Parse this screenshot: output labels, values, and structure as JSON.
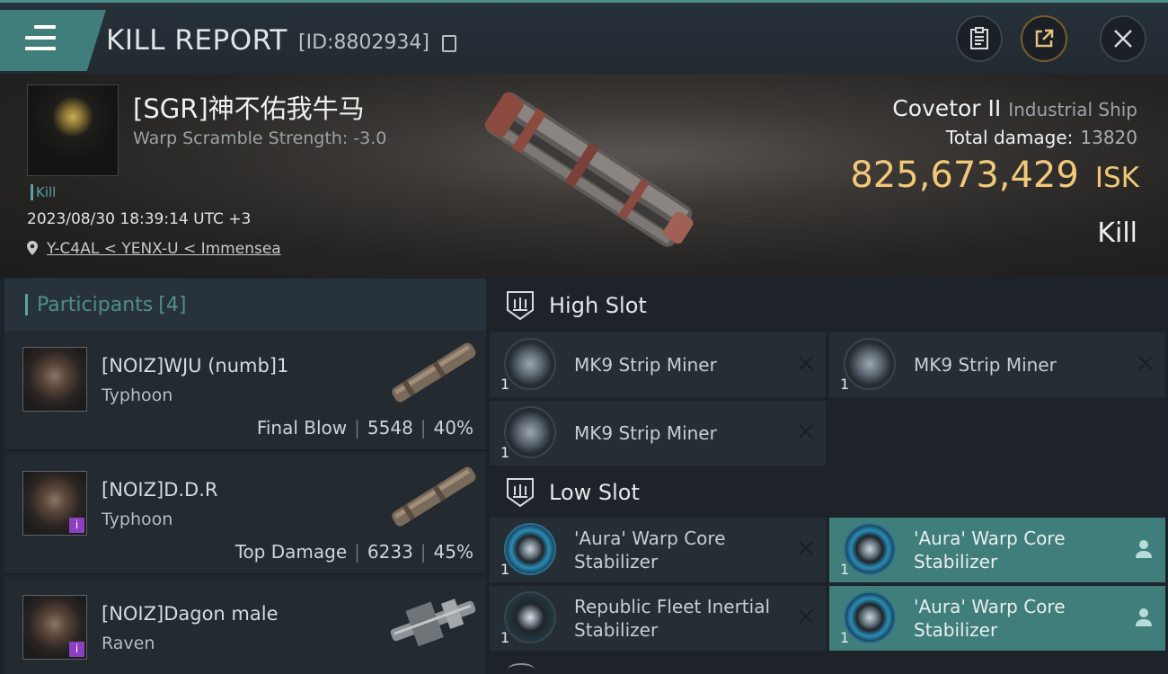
{
  "header": {
    "title": "KILL REPORT",
    "report_id": "[ID:8802934]"
  },
  "victim": {
    "name": "[SGR]神不佑我牛马",
    "warp_scramble": "Warp Scramble Strength: -3.0",
    "kill_tag": "Kill",
    "timestamp": "2023/08/30 18:39:14 UTC +3",
    "location": "Y-C4AL < YENX-U < Immensea",
    "ship_name": "Covetor II",
    "ship_class": "Industrial Ship",
    "total_damage_label": "Total damage:",
    "total_damage": "13820",
    "isk_value": "825,673,429",
    "isk_unit": "ISK",
    "result": "Kill"
  },
  "participants": {
    "title": "Participants",
    "count": "[4]",
    "items": [
      {
        "name": "[NOIZ]WJU (numb]1",
        "ship": "Typhoon",
        "stat_label": "Final Blow",
        "damage": "5548",
        "percent": "40%"
      },
      {
        "name": "[NOIZ]D.D.R",
        "ship": "Typhoon",
        "stat_label": "Top Damage",
        "damage": "6233",
        "percent": "45%"
      },
      {
        "name": "[NOIZ]Dagon male",
        "ship": "Raven"
      }
    ],
    "badge_letter": "i"
  },
  "slots": {
    "high": {
      "title": "High Slot",
      "modules": [
        {
          "qty": "1",
          "name": "MK9 Strip Miner"
        },
        {
          "qty": "1",
          "name": "MK9 Strip Miner"
        },
        {
          "qty": "1",
          "name": "MK9 Strip Miner"
        }
      ]
    },
    "low": {
      "title": "Low Slot",
      "modules": [
        {
          "qty": "1",
          "name": "'Aura' Warp Core Stabilizer"
        },
        {
          "qty": "1",
          "name": "'Aura' Warp Core Stabilizer"
        },
        {
          "qty": "1",
          "name": "Republic Fleet Inertial Stabilizer"
        },
        {
          "qty": "1",
          "name": "'Aura' Warp Core Stabilizer"
        }
      ]
    }
  },
  "colors": {
    "accent_teal": "#3f7e7b",
    "isk_gold": "#f2c878",
    "corp_badge": "#8c3fc2"
  }
}
